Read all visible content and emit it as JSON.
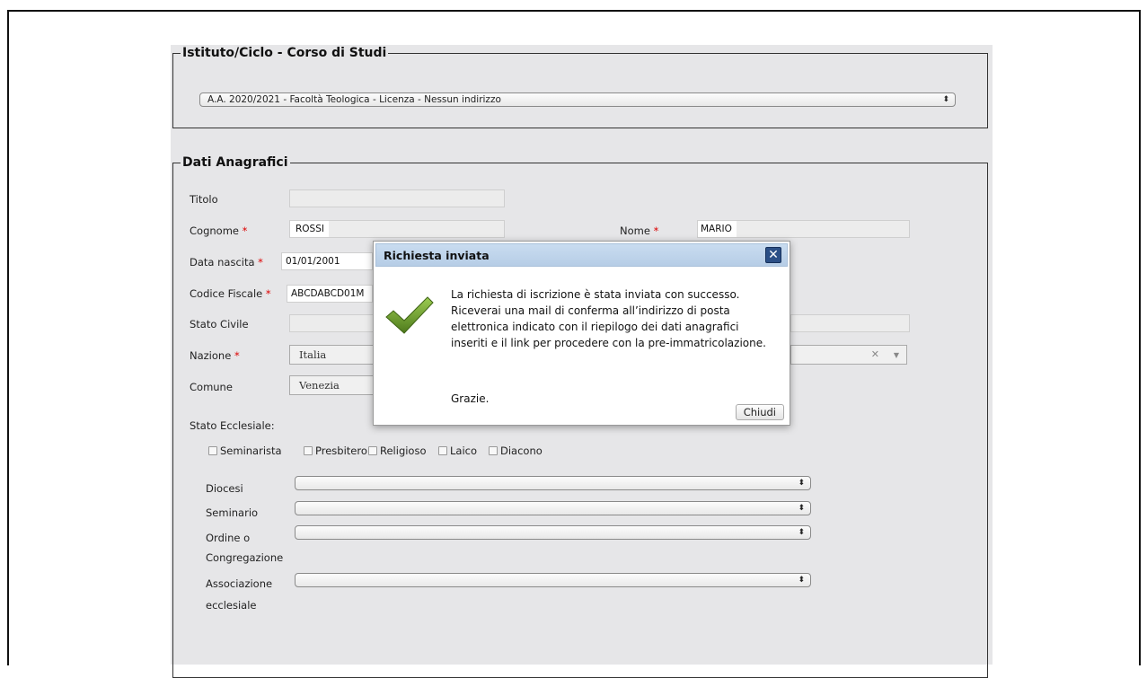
{
  "course_section": {
    "legend": "Istituto/Ciclo - Corso di Studi",
    "selected_course": "A.A. 2020/2021 - Facoltà Teologica - Licenza - Nessun indirizzo"
  },
  "personal_section": {
    "legend": "Dati Anagrafici",
    "titolo_label": "Titolo",
    "titolo_value": "",
    "cognome_label": "Cognome",
    "cognome_value": "ROSSI",
    "nome_label": "Nome",
    "nome_value": "MARIO",
    "data_nascita_label": "Data nascita",
    "data_nascita_value": "01/01/2001",
    "codice_fiscale_label": "Codice Fiscale",
    "codice_fiscale_value": "ABCDABCD01M",
    "stato_civile_label": "Stato Civile",
    "nazione_label": "Nazione",
    "nazione_value": "Italia",
    "comune_label": "Comune",
    "comune_value": "Venezia",
    "required_mark": "*",
    "stato_ecclesiale_label": "Stato Ecclesiale:",
    "stato_ecclesiale_options": [
      "Seminarista",
      "Presbitero",
      "Religioso",
      "Laico",
      "Diacono"
    ],
    "diocesi_label": "Diocesi",
    "seminario_label": "Seminario",
    "ordine_label_1": "Ordine o",
    "ordine_label_2": "Congregazione",
    "associazione_label_1": "Associazione",
    "associazione_label_2": "ecclesiale"
  },
  "modal": {
    "title": "Richiesta inviata",
    "close_glyph": "✕",
    "message": "La richiesta di iscrizione è stata inviata con successo. Riceverai una mail di conferma all’indirizzo di posta elettronica indicato con il riepilogo dei dati anagrafici inseriti e il link per procedere con la pre-immatricolazione.",
    "thanks": "Grazie.",
    "close_button": "Chiudi",
    "icon": "checkmark-icon"
  },
  "icons": {
    "select_arrows": "⬍",
    "clear": "✕",
    "dropdown": "▼"
  },
  "colors": {
    "required": "#dd0000",
    "modal_header": "#c9dcf0",
    "close_button": "#2b4f86",
    "check_green": "#6a9a2a"
  }
}
